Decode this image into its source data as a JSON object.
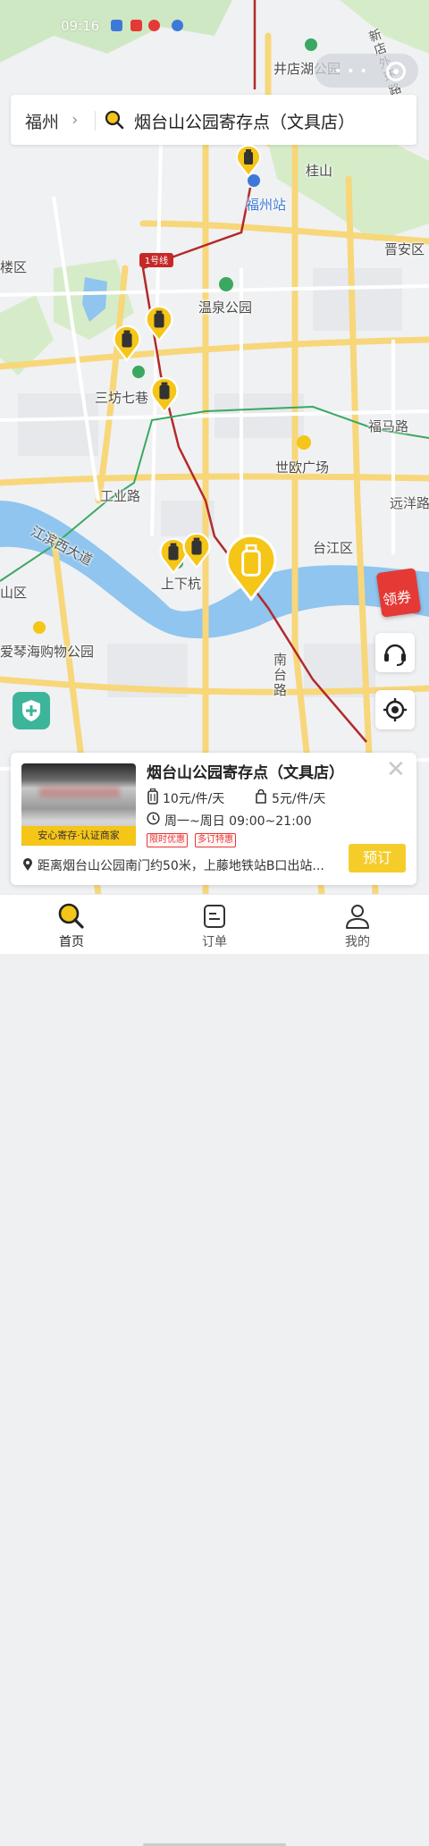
{
  "status_bar": {
    "time": "09:16"
  },
  "search": {
    "city": "福州",
    "query": "烟台山公园寄存点（文具店）"
  },
  "map": {
    "labels": {
      "jingdianhu": "井店湖公园",
      "guishan": "桂山",
      "fuzhou_station": "福州站",
      "jinan_district": "晋安区",
      "gulou_district": "楼区",
      "wenquan_park": "温泉公园",
      "sanfang": "三坊七巷",
      "fuma_road": "福马路",
      "shiou_square": "世欧广场",
      "gongye_road": "工业路",
      "yuanyang_road": "远洋路",
      "jiangbin_road": "江滨西大道",
      "taijiang_district": "台江区",
      "shangxiahang": "上下杭",
      "cangshan_district": "山区",
      "aiqinhai_park": "爱琴海购物公园",
      "nantai_road": "南台路",
      "line1": "1号线",
      "xindian_road": "新店外环路"
    }
  },
  "coupon": {
    "label": "领券"
  },
  "card": {
    "title": "烟台山公园寄存点（文具店）",
    "cert_badge": "安心寄存·认证商家",
    "price_large": "10元/件/天",
    "price_small": "5元/件/天",
    "hours": "周一~周日 09:00~21:00",
    "tags": [
      "限时优惠",
      "多订特惠"
    ],
    "address": "距离烟台山公园南门约50米，上藤地铁站B口出站...",
    "book_label": "预订"
  },
  "tabs": [
    {
      "label": "首页",
      "active": true
    },
    {
      "label": "订单",
      "active": false
    },
    {
      "label": "我的",
      "active": false
    }
  ],
  "colors": {
    "accent": "#f5c518",
    "active_text": "#222",
    "inactive_text": "#555"
  }
}
